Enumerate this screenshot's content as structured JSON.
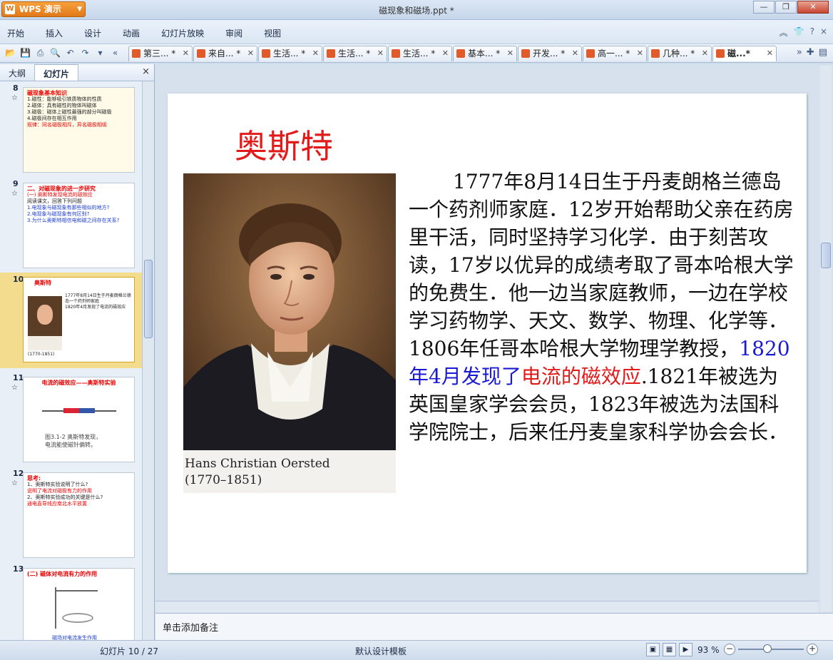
{
  "app": {
    "brand": "WPS 演示",
    "window_title": "磁现象和磁场.ppt *"
  },
  "menu": [
    "开始",
    "插入",
    "设计",
    "动画",
    "幻灯片放映",
    "审阅",
    "视图"
  ],
  "tabs": [
    {
      "label": "第三... *"
    },
    {
      "label": "来自... *"
    },
    {
      "label": "生活... *"
    },
    {
      "label": "生活... *"
    },
    {
      "label": "生活... *"
    },
    {
      "label": "基本... *"
    },
    {
      "label": "开发... *"
    },
    {
      "label": "高一... *"
    },
    {
      "label": "几种... *"
    },
    {
      "label": "磁...*"
    }
  ],
  "left_panel": {
    "tab_outline": "大纲",
    "tab_slides": "幻灯片",
    "close": "×"
  },
  "thumbnails": [
    {
      "num": "8",
      "title": "磁现象基本知识",
      "lines": [
        "1.磁性：能够吸引铁质物体的性质",
        "2.磁体：具有磁性的物体叫磁体",
        "3.磁极：磁体上磁性最强的部分叫磁极",
        "4.磁极间存在相互作用",
        "规律：同名磁极相斥，异名磁极相吸"
      ]
    },
    {
      "num": "9",
      "title": "二、对磁现象的进一步研究",
      "lines": [
        "(一) 奥斯特发现电流的磁效应",
        "阅读课文，回答下列问题",
        "1.电现象与磁现象有那些相似的地方?",
        "2.电现象与磁现象有何区别?",
        "3.为什么奥斯特相信电和磁之间存在关系?"
      ]
    },
    {
      "num": "10",
      "title": "奥斯特",
      "lines": [
        "1777年8月14日生于丹麦朗格兰德岛一个药剂师家庭",
        "1820年4月发现了电流的磁效应",
        "(1770-1851)"
      ]
    },
    {
      "num": "11",
      "title": "电流的磁效应——奥斯特实验",
      "lines": [
        "图3.1-2 奥斯特发现，",
        "电流能使磁针偏转。"
      ]
    },
    {
      "num": "12",
      "title": "思考:",
      "lines": [
        "1、奥斯特实验说明了什么?",
        "说明了电流对磁极有力的作用",
        "2、奥斯特实验成功的关键是什么?",
        "通电直导线应南北水平放置"
      ]
    },
    {
      "num": "13",
      "title": "(二) 磁体对电流有力的作用",
      "lines": [
        "磁场对电流发生作用"
      ]
    }
  ],
  "slide": {
    "title": "奥斯特",
    "caption_name": "Hans Christian Oersted",
    "caption_years": "(1770–1851)",
    "bio_part1": "1777年8月14日生于丹麦朗格兰德岛一个药剂师家庭．12岁开始帮助父亲在药房里干活，同时坚持学习化学．由于刻苦攻读，17岁以优异的成绩考取了哥本哈根大学的免费生．他一边当家庭教师，一边在学校学习药物学、天文、数学、物理、化学等．1806年任哥本哈根大学物理学教授，",
    "bio_blue": "1820年4月发现了",
    "bio_red": "电流的磁效应",
    "bio_part2": ".1821年被选为英国皇家学会会员，1823年被选为法国科学院院士，后来任丹麦皇家科学协会会长．"
  },
  "notes_placeholder": "单击添加备注",
  "status": {
    "slide_info": "幻灯片 10 / 27",
    "template": "默认设计模板",
    "zoom": "93 %"
  },
  "colors": {
    "title_red": "#e21a1a",
    "highlight_blue": "#1a1ad6",
    "wps_orange": "#e0781a"
  }
}
